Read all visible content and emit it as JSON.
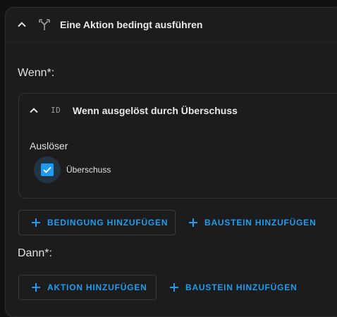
{
  "header": {
    "title": "Eine Aktion bedingt ausführen",
    "icon": "call-split-icon",
    "toggle_icon": "chevron-up-icon"
  },
  "if_section": {
    "label": "Wenn*:",
    "condition": {
      "badge": "ID",
      "title": "Wenn ausgelöst durch Überschuss",
      "field_label": "Auslöser",
      "options": [
        {
          "label": "Überschuss",
          "checked": true
        }
      ]
    },
    "buttons": [
      {
        "label": "BEDINGUNG HINZUFÜGEN",
        "style": "outlined"
      },
      {
        "label": "BAUSTEIN HINZUFÜGEN",
        "style": "text"
      }
    ]
  },
  "then_section": {
    "label": "Dann*:",
    "buttons": [
      {
        "label": "AKTION HINZUFÜGEN",
        "style": "outlined"
      },
      {
        "label": "BAUSTEIN HINZUFÜGEN",
        "style": "text"
      }
    ]
  },
  "colors": {
    "accent": "#1e9cef",
    "background": "#111111",
    "card": "#1c1c1c",
    "border": "#333333",
    "text": "#e1e1e1"
  }
}
